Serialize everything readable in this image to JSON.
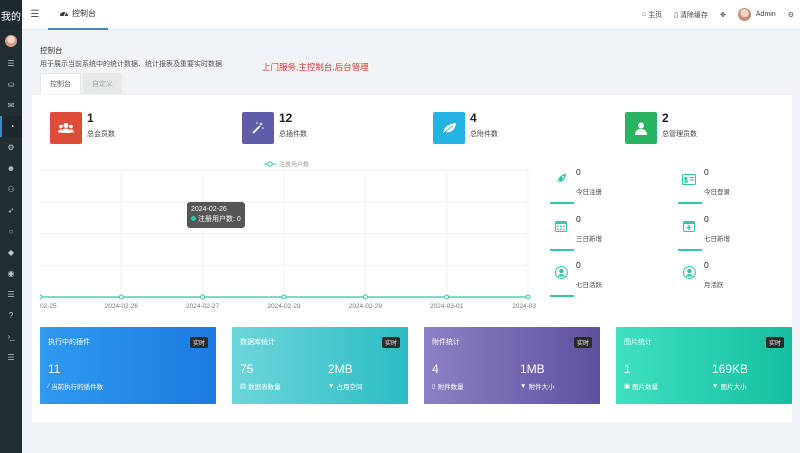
{
  "sidebar": {
    "logo": "我的"
  },
  "header": {
    "tab_label": "控制台",
    "home": "主页",
    "clear_cache": "清除缓存",
    "user_name": "Admin"
  },
  "page": {
    "title": "控制台",
    "description": "用于展示当前系统中的统计数据、统计报表及重要实时数据",
    "red_note": "上门服务,主控制台,后台管理",
    "subtabs": [
      "控制台",
      "自定义"
    ]
  },
  "stats": [
    {
      "value": "1",
      "label": "总会员数",
      "color": "#dd4b39"
    },
    {
      "value": "12",
      "label": "总插件数",
      "color": "#605ca8"
    },
    {
      "value": "4",
      "label": "总附件数",
      "color": "#24b3e0"
    },
    {
      "value": "2",
      "label": "总管理员数",
      "color": "#28b463"
    }
  ],
  "chart_data": {
    "type": "line",
    "title": "",
    "legend": "注册用户数",
    "x": [
      "02-25",
      "2024-02-26",
      "2024-02-27",
      "2024-02-28",
      "2024-02-29",
      "2024-03-01",
      "2024-03"
    ],
    "series": [
      {
        "name": "注册用户数",
        "values": [
          0,
          0,
          0,
          0,
          0,
          0,
          0
        ]
      }
    ],
    "xlabel": "",
    "ylabel": "",
    "tooltip": {
      "date": "2024-02-26",
      "text": "注册用户数: 0"
    }
  },
  "mini_stats": [
    {
      "value": "0",
      "label": "今日注册",
      "icon": "rocket-icon"
    },
    {
      "value": "0",
      "label": "今日登录",
      "icon": "id-card-icon"
    },
    {
      "value": "0",
      "label": "三日新增",
      "icon": "calendar-icon"
    },
    {
      "value": "0",
      "label": "七日新增",
      "icon": "calendar-plus-icon"
    },
    {
      "value": "0",
      "label": "七日活跃",
      "icon": "user-circle-icon"
    },
    {
      "value": "0",
      "label": "月活跃",
      "icon": "user-circle-icon"
    }
  ],
  "cards": [
    {
      "title": "执行中的插件",
      "badge": "实时",
      "v1": "11",
      "l1": "当前执行的插件数",
      "v2": "",
      "l2": "",
      "color1": "#2f9af0",
      "color2": "#1c7ae0"
    },
    {
      "title": "数据库统计",
      "badge": "实时",
      "v1": "75",
      "l1": "数据表数量",
      "v2": "2MB",
      "l2": "占用空间",
      "color1": "#6dd6db",
      "color2": "#2bbcc3"
    },
    {
      "title": "附件统计",
      "badge": "实时",
      "v1": "4",
      "l1": "附件数量",
      "v2": "1MB",
      "l2": "附件大小",
      "color1": "#8d80c4",
      "color2": "#5f509f"
    },
    {
      "title": "图片统计",
      "badge": "实时",
      "v1": "1",
      "l1": "图片数量",
      "v2": "169KB",
      "l2": "图片大小",
      "color1": "#3fe0c0",
      "color2": "#14bfa0"
    }
  ]
}
